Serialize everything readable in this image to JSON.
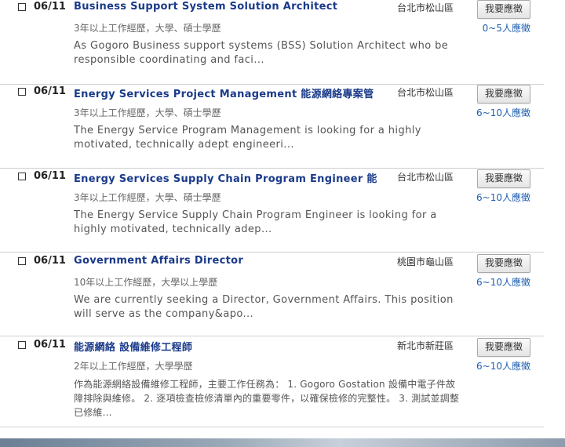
{
  "jobs": [
    {
      "date": "06/11",
      "title": "Business Support System Solution Architect",
      "location": "台北市松山區",
      "apply_label": "我要應徵",
      "applicants": "0~5人應徵",
      "requirements": "3年以上工作經歷，大學、碩士學歷",
      "description": "As Gogoro Business support systems (BSS) Solution Architect who be responsible coordinating and faci..."
    },
    {
      "date": "06/11",
      "title": "Energy Services Project Management 能源網絡專案管",
      "location": "台北市松山區",
      "apply_label": "我要應徵",
      "applicants": "6~10人應徵",
      "requirements": "3年以上工作經歷，大學、碩士學歷",
      "description": "The Energy Service Program Management is looking for a highly motivated, technically adept engineeri..."
    },
    {
      "date": "06/11",
      "title": "Energy Services Supply Chain Program Engineer 能",
      "location": "台北市松山區",
      "apply_label": "我要應徵",
      "applicants": "6~10人應徵",
      "requirements": "3年以上工作經歷，大學、碩士學歷",
      "description": "The Energy Service Supply Chain Program Engineer is looking for a highly motivated, technically adep..."
    },
    {
      "date": "06/11",
      "title": "Government Affairs Director",
      "location": "桃園市龜山區",
      "apply_label": "我要應徵",
      "applicants": "6~10人應徵",
      "requirements": "10年以上工作經歷，大學以上學歷",
      "description": "We are currently seeking a Director, Government Affairs. This position will serve as the company&apo..."
    },
    {
      "date": "06/11",
      "title": "能源網絡 設備維修工程師",
      "location": "新北市新莊區",
      "apply_label": "我要應徵",
      "applicants": "6~10人應徵",
      "requirements": "2年以上工作經歷，大學學歷",
      "description": "作為能源網絡設備維修工程師，主要工作任務為： 1. Gogoro Gostation 設備中電子件故障排除與維修。 2. 逐項檢查檢修清單內的重要零件，以確保檢修的完整性。 3. 測試並調整已修維..."
    }
  ]
}
